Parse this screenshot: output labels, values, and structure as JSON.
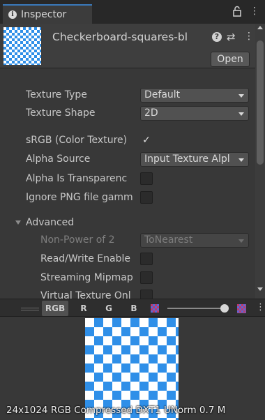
{
  "tab": {
    "icon": "info-icon",
    "label": "Inspector",
    "lock_icon": "lock-icon",
    "menu_icon": "kebab-menu-icon"
  },
  "header": {
    "asset_name": "Checkerboard-squares-bl",
    "help_icon": "help-icon",
    "settings_icon": "preset-settings-icon",
    "menu_icon": "kebab-menu-icon",
    "open_label": "Open",
    "accent": "#2f8fe8"
  },
  "properties": {
    "texture_type": {
      "label": "Texture Type",
      "value": "Default"
    },
    "texture_shape": {
      "label": "Texture Shape",
      "value": "2D"
    },
    "srgb": {
      "label": "sRGB (Color Texture)",
      "checked": true,
      "mark": "✓"
    },
    "alpha_source": {
      "label": "Alpha Source",
      "value": "Input Texture Alpl"
    },
    "alpha_transparency": {
      "label": "Alpha Is Transparenc",
      "checked": false,
      "mark": ""
    },
    "ignore_png_gamma": {
      "label": "Ignore PNG file gamm",
      "checked": false,
      "mark": ""
    },
    "advanced": {
      "label": "Advanced",
      "expanded": true,
      "non_power_of_2": {
        "label": "Non-Power of 2",
        "value": "ToNearest",
        "enabled": false
      },
      "read_write": {
        "label": "Read/Write Enable",
        "checked": false,
        "mark": ""
      },
      "streaming_mipmaps": {
        "label": "Streaming Mipmap",
        "checked": false,
        "mark": ""
      },
      "virtual_texture_only": {
        "label": "Virtual Texture Onl",
        "checked": false,
        "mark": ""
      }
    }
  },
  "preview_toolbar": {
    "rgb": "RGB",
    "r": "R",
    "g": "G",
    "b": "B",
    "alpha_icon": "alpha-channel-icon",
    "mip_icon": "mip-level-icon",
    "menu_icon": "kebab-menu-icon",
    "mip_slider_level": 1.0
  },
  "preview": {
    "info_text": "24x1024  RGB Compressed DXT1 UNorm   0.7 M"
  }
}
